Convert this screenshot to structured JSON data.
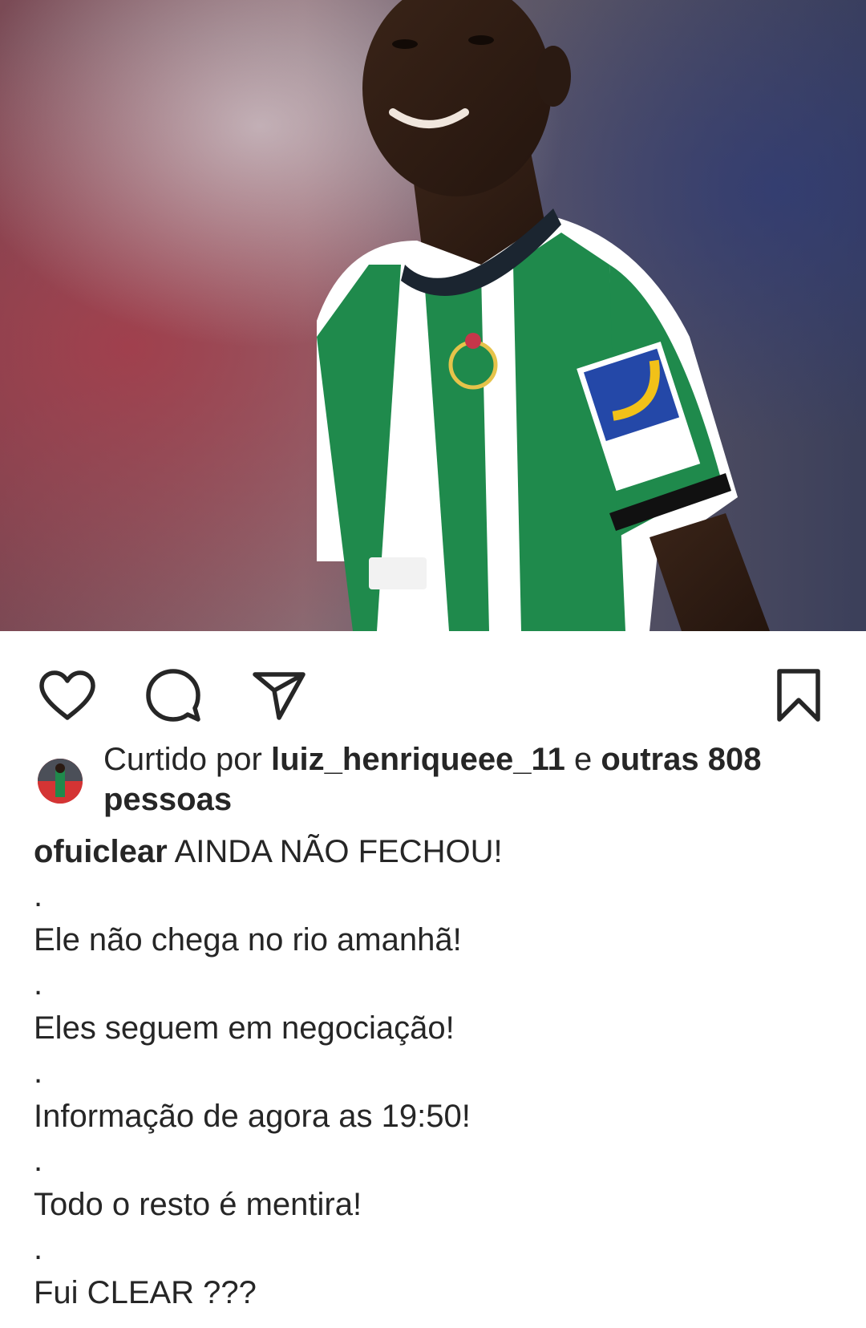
{
  "post": {
    "photo_alt": "",
    "accent_colors": {
      "jersey_green": "#1f8a4c",
      "text": "#262626"
    }
  },
  "actions": {
    "like_icon": "heart-icon",
    "comment_icon": "comment-icon",
    "share_icon": "send-icon",
    "save_icon": "bookmark-icon"
  },
  "likes": {
    "prefix": "Curtido por",
    "user": "luiz_henriqueee_11",
    "connector": "e",
    "others": "outras 808",
    "suffix": "pessoas"
  },
  "caption": {
    "username": "ofuiclear",
    "headline": "AINDA NÃO FECHOU!",
    "lines": [
      ".",
      "Ele não chega no rio amanhã!",
      ".",
      "Eles seguem em negociação!",
      ".",
      "Informação de agora as 19:50!",
      ".",
      "Todo o resto é mentira!",
      ".",
      "Fui CLEAR ???"
    ]
  }
}
